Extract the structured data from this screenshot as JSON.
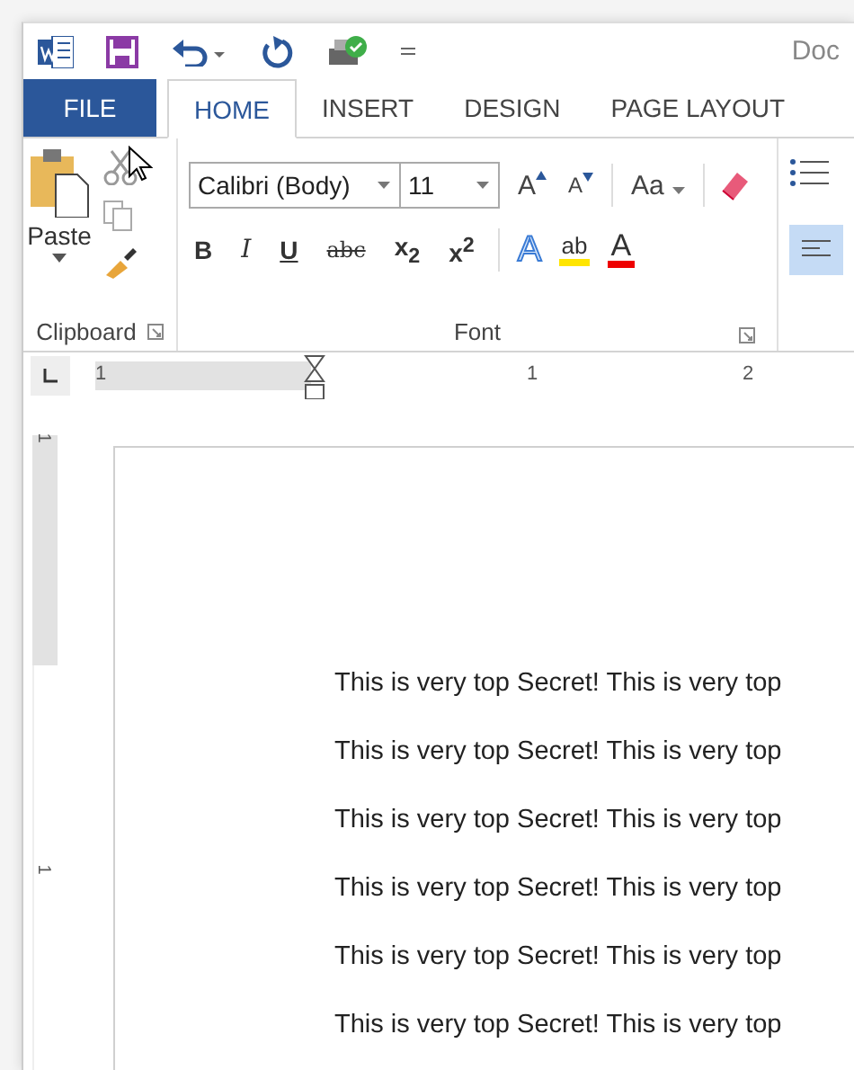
{
  "title": "Doc",
  "tabs": [
    {
      "label": "FILE",
      "kind": "file",
      "selected": false
    },
    {
      "label": "HOME",
      "kind": "tab",
      "selected": true
    },
    {
      "label": "INSERT",
      "kind": "tab",
      "selected": false
    },
    {
      "label": "DESIGN",
      "kind": "tab",
      "selected": false
    },
    {
      "label": "PAGE LAYOUT",
      "kind": "tab",
      "selected": false
    }
  ],
  "clipboard": {
    "paste": "Paste",
    "group": "Clipboard"
  },
  "font": {
    "family": "Calibri (Body)",
    "size": "11",
    "grow": "A",
    "shrink": "A",
    "case": "Aa",
    "group": "Font",
    "format_buttons": [
      {
        "label": "B",
        "kind": "bold"
      },
      {
        "label": "I",
        "kind": "italic"
      },
      {
        "label": "U",
        "kind": "underline"
      },
      {
        "label": "abc",
        "kind": "strike"
      },
      {
        "label": "x$_{2}$",
        "kind": "script"
      },
      {
        "label": "x$^{2}$",
        "kind": "script"
      }
    ],
    "effects": "A",
    "highlight": "ab",
    "font_color": "A"
  },
  "paragraph": {
    "align_left_selected": true
  },
  "ruler": {
    "ticks": [
      "1",
      "1",
      "2"
    ]
  },
  "vertical_ruler": {
    "ticks": [
      "1",
      "1"
    ]
  },
  "document": {
    "lines": [
      "This is very top Secret! This is very top",
      "This is very top Secret! This is very top",
      "This is very top Secret! This is very top",
      "This is very top Secret! This is very top",
      "This is very top Secret! This is very top",
      "This is very top Secret! This is very top"
    ]
  }
}
